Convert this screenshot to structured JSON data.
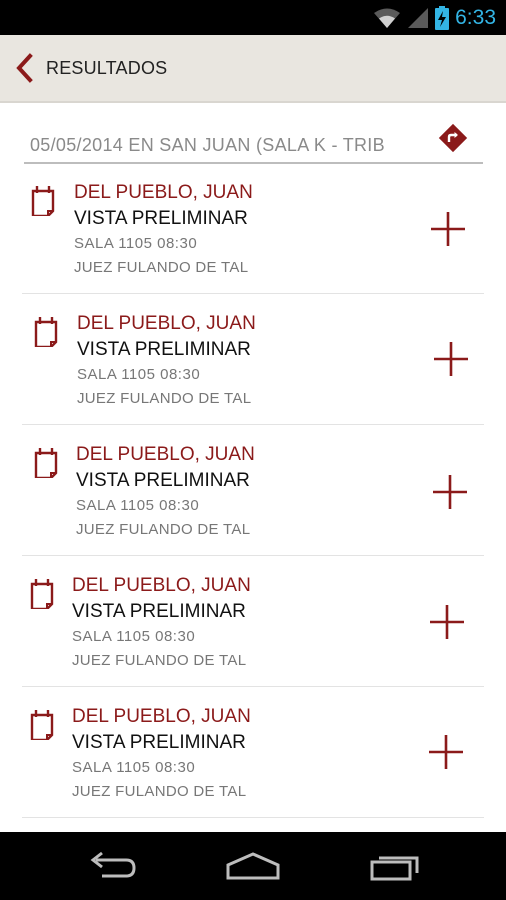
{
  "status_bar": {
    "time": "6:33",
    "icons": [
      "wifi-icon",
      "signal-icon",
      "battery-charging-icon"
    ],
    "accent_color": "#33b5e5"
  },
  "action_bar": {
    "title": "RESULTADOS",
    "back_icon": "chevron-left-icon"
  },
  "header": {
    "summary": "05/05/2014  EN  SAN JUAN (SALA K - TRIB",
    "action_icon": "directions-icon"
  },
  "results": [
    {
      "name": "DEL PUEBLO, JUAN",
      "type": "VISTA PRELIMINAR",
      "detail": "SALA  1105  08:30",
      "judge": "JUEZ FULANDO DE TAL"
    },
    {
      "name": "DEL PUEBLO, JUAN",
      "type": "VISTA PRELIMINAR",
      "detail": "SALA  1105  08:30",
      "judge": "JUEZ FULANDO DE TAL"
    },
    {
      "name": "DEL PUEBLO, JUAN",
      "type": "VISTA PRELIMINAR",
      "detail": "SALA  1105  08:30",
      "judge": "JUEZ FULANDO DE TAL"
    },
    {
      "name": "DEL PUEBLO, JUAN",
      "type": "VISTA PRELIMINAR",
      "detail": "SALA  1105  08:30",
      "judge": "JUEZ FULANDO DE TAL"
    },
    {
      "name": "DEL PUEBLO, JUAN",
      "type": "VISTA PRELIMINAR",
      "detail": "SALA  1105  08:30",
      "judge": "JUEZ FULANDO DE TAL"
    }
  ],
  "colors": {
    "accent": "#8b1a1a",
    "action_bar_bg": "#e9e6e0"
  },
  "nav_bar": {
    "icons": [
      "back-icon",
      "home-icon",
      "recents-icon"
    ]
  }
}
